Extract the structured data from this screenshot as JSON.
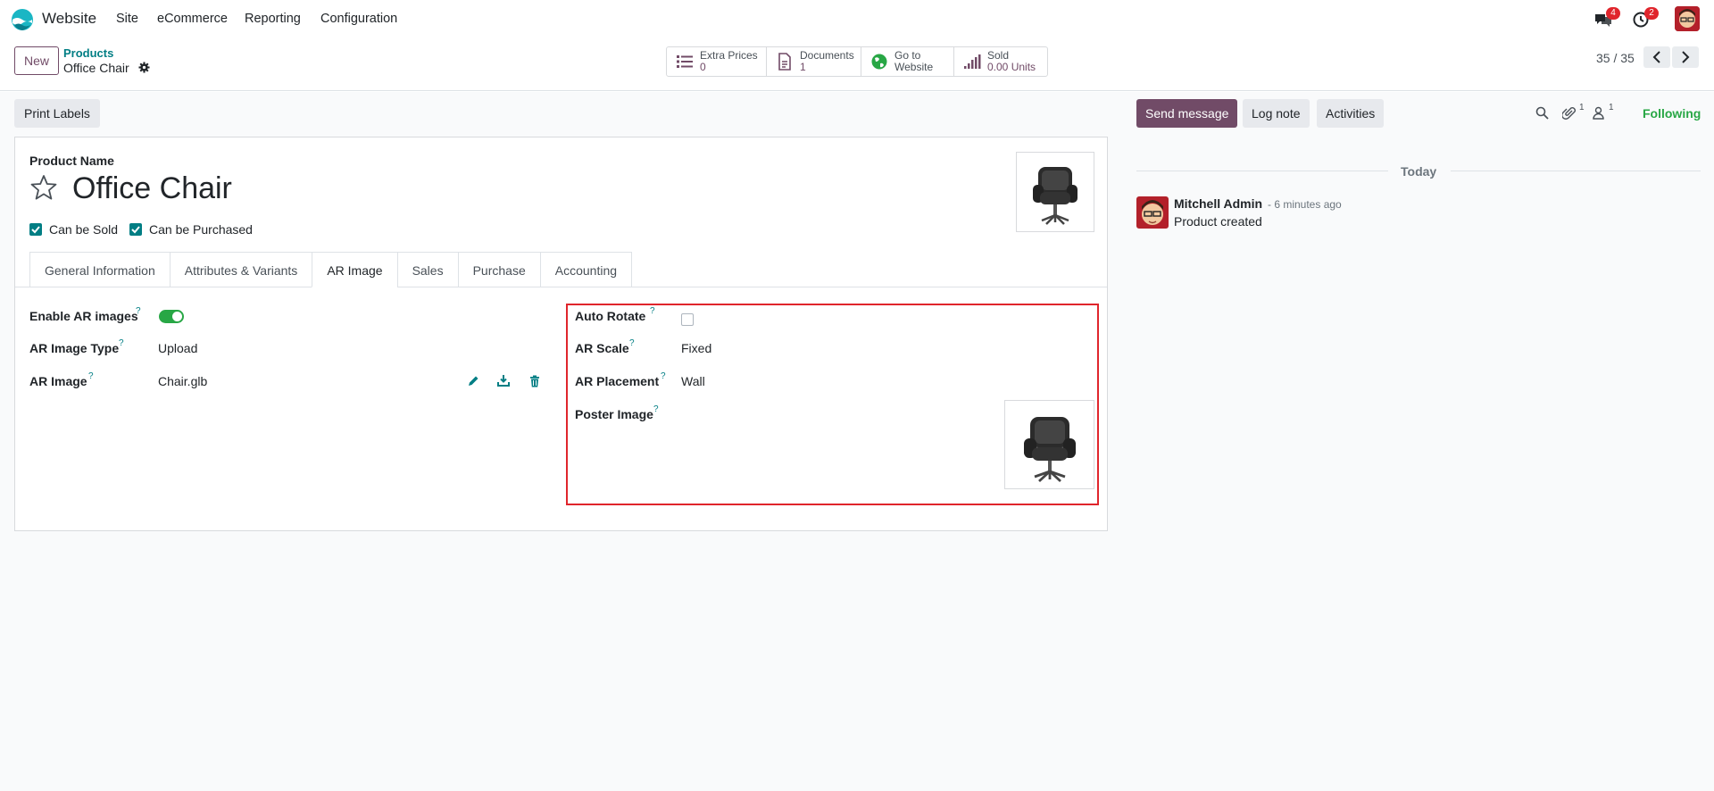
{
  "app": {
    "name": "Website",
    "logo_icon": "odoo-website-logo"
  },
  "menu": [
    "Site",
    "eCommerce",
    "Reporting",
    "Configuration"
  ],
  "systray": {
    "messages_badge": "4",
    "activities_badge": "2"
  },
  "control": {
    "new_label": "New",
    "breadcrumb_parent": "Products",
    "breadcrumb_current": "Office Chair",
    "pager": "35 / 35"
  },
  "smart_buttons": [
    {
      "icon": "list-icon",
      "label": "Extra Prices",
      "value": "0"
    },
    {
      "icon": "document-icon",
      "label": "Documents",
      "value": "1"
    },
    {
      "icon": "globe-icon",
      "label": "Go to",
      "value": "Website"
    },
    {
      "icon": "bar-chart-icon",
      "label": "Sold",
      "value": "0.00 Units"
    }
  ],
  "toolbar": {
    "print_labels": "Print Labels"
  },
  "form": {
    "product_name_label": "Product Name",
    "product_name": "Office Chair",
    "can_be_sold": "Can be Sold",
    "can_be_purchased": "Can be Purchased"
  },
  "tabs": [
    "General Information",
    "Attributes & Variants",
    "AR Image",
    "Sales",
    "Purchase",
    "Accounting"
  ],
  "ar": {
    "enable_label": "Enable AR images",
    "type_label": "AR Image Type",
    "type_value": "Upload",
    "image_label": "AR Image",
    "image_value": "Chair.glb",
    "auto_rotate_label": "Auto Rotate",
    "scale_label": "AR Scale",
    "scale_value": "Fixed",
    "placement_label": "AR Placement",
    "placement_value": "Wall",
    "poster_label": "Poster Image",
    "help_mark": "?"
  },
  "chatter": {
    "send_message": "Send message",
    "log_note": "Log note",
    "activities": "Activities",
    "attachments_count": "1",
    "followers_count": "1",
    "following": "Following",
    "today": "Today",
    "author": "Mitchell Admin",
    "time": "- 6 minutes ago",
    "body": "Product created"
  },
  "colors": {
    "brand": "#714b67",
    "accent": "#017e84",
    "highlight": "#e0252c",
    "success": "#28a745"
  }
}
